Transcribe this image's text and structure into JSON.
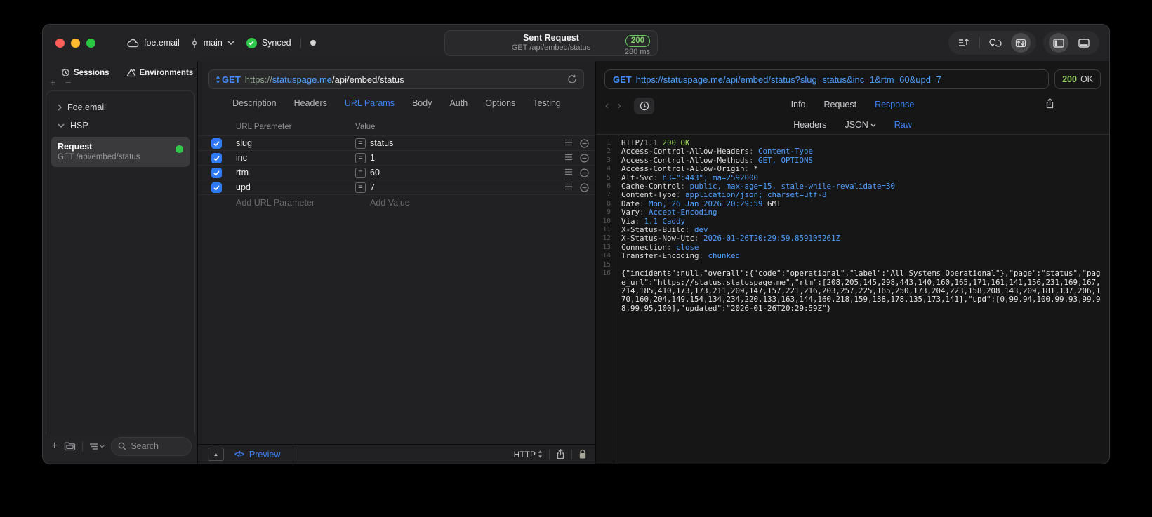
{
  "colors": {
    "accent_blue": "#3b82f7",
    "link_blue": "#4d9fff",
    "method_blue": "#3f8cff",
    "green": "#32c74b",
    "code_green": "#9fd45f",
    "badge_green": "#7ccf63"
  },
  "titlebar": {
    "project": "foe.email",
    "branch": "main",
    "sync_status": "Synced",
    "sent_request": {
      "title": "Sent Request",
      "subtitle": "GET /api/embed/status",
      "status_code": "200",
      "duration": "280 ms"
    }
  },
  "sidebar": {
    "tab_sessions": "Sessions",
    "tab_environments": "Environments",
    "tree": {
      "group1": "Foe.email",
      "group2": "HSP"
    },
    "request": {
      "title": "Request",
      "subtitle": "GET /api/embed/status"
    },
    "search_placeholder": "Search"
  },
  "request_editor": {
    "method": "GET",
    "url": {
      "scheme": "https://",
      "host": "statuspage.me",
      "path": "/api/embed/status"
    },
    "tabs": [
      "Description",
      "Headers",
      "URL Params",
      "Body",
      "Auth",
      "Options",
      "Testing"
    ],
    "active_tab": "URL Params",
    "params": {
      "col_name": "URL Parameter",
      "col_value": "Value",
      "rows": [
        {
          "name": "slug",
          "value": "status"
        },
        {
          "name": "inc",
          "value": "1"
        },
        {
          "name": "rtm",
          "value": "60"
        },
        {
          "name": "upd",
          "value": "7"
        }
      ],
      "add_name": "Add URL Parameter",
      "add_value": "Add Value"
    },
    "footer": {
      "preview": "Preview",
      "protocol": "HTTP"
    }
  },
  "response_viewer": {
    "method": "GET",
    "url": "https://statuspage.me/api/embed/status?slug=status&inc=1&rtm=60&upd=7",
    "status_code": "200",
    "status_text": "OK",
    "tabs": [
      "Info",
      "Request",
      "Response"
    ],
    "active_tab": "Response",
    "subtabs": [
      "Headers",
      "JSON",
      "Raw"
    ],
    "active_subtab": "Raw",
    "lines": [
      {
        "n": "1",
        "segs": [
          {
            "t": "HTTP/1.1 ",
            "c": "k"
          },
          {
            "t": "200 OK",
            "c": "g"
          }
        ]
      },
      {
        "n": "2",
        "segs": [
          {
            "t": "Access-Control-Allow-Headers",
            "c": "k"
          },
          {
            "t": ": ",
            "c": "p"
          },
          {
            "t": "Content-Type",
            "c": "v"
          }
        ]
      },
      {
        "n": "3",
        "segs": [
          {
            "t": "Access-Control-Allow-Methods",
            "c": "k"
          },
          {
            "t": ": ",
            "c": "p"
          },
          {
            "t": "GET, OPTIONS",
            "c": "v"
          }
        ]
      },
      {
        "n": "4",
        "segs": [
          {
            "t": "Access-Control-Allow-Origin",
            "c": "k"
          },
          {
            "t": ": ",
            "c": "p"
          },
          {
            "t": "*",
            "c": "k"
          }
        ]
      },
      {
        "n": "5",
        "segs": [
          {
            "t": "Alt-Svc",
            "c": "k"
          },
          {
            "t": ": ",
            "c": "p"
          },
          {
            "t": "h3=\":443\"; ma=2592000",
            "c": "v"
          }
        ]
      },
      {
        "n": "6",
        "segs": [
          {
            "t": "Cache-Control",
            "c": "k"
          },
          {
            "t": ": ",
            "c": "p"
          },
          {
            "t": "public, max-age=15, stale-while-revalidate=30",
            "c": "v"
          }
        ]
      },
      {
        "n": "7",
        "segs": [
          {
            "t": "Content-Type",
            "c": "k"
          },
          {
            "t": ": ",
            "c": "p"
          },
          {
            "t": "application/json; charset=utf-8",
            "c": "v"
          }
        ]
      },
      {
        "n": "8",
        "segs": [
          {
            "t": "Date",
            "c": "k"
          },
          {
            "t": ": ",
            "c": "p"
          },
          {
            "t": "Mon, 26 Jan 2026 20:29:59",
            "c": "v"
          },
          {
            "t": " GMT",
            "c": "k"
          }
        ]
      },
      {
        "n": "9",
        "segs": [
          {
            "t": "Vary",
            "c": "k"
          },
          {
            "t": ": ",
            "c": "p"
          },
          {
            "t": "Accept-Encoding",
            "c": "v"
          }
        ]
      },
      {
        "n": "10",
        "segs": [
          {
            "t": "Via",
            "c": "k"
          },
          {
            "t": ": ",
            "c": "p"
          },
          {
            "t": "1.1 Caddy",
            "c": "v"
          }
        ]
      },
      {
        "n": "11",
        "segs": [
          {
            "t": "X-Status-Build",
            "c": "k"
          },
          {
            "t": ": ",
            "c": "p"
          },
          {
            "t": "dev",
            "c": "v"
          }
        ]
      },
      {
        "n": "12",
        "segs": [
          {
            "t": "X-Status-Now-Utc",
            "c": "k"
          },
          {
            "t": ": ",
            "c": "p"
          },
          {
            "t": "2026-01-26T20:29:59.859105261Z",
            "c": "v"
          }
        ]
      },
      {
        "n": "13",
        "segs": [
          {
            "t": "Connection",
            "c": "k"
          },
          {
            "t": ": ",
            "c": "p"
          },
          {
            "t": "close",
            "c": "v"
          }
        ]
      },
      {
        "n": "14",
        "segs": [
          {
            "t": "Transfer-Encoding",
            "c": "k"
          },
          {
            "t": ": ",
            "c": "p"
          },
          {
            "t": "chunked",
            "c": "v"
          }
        ]
      },
      {
        "n": "15",
        "segs": []
      },
      {
        "n": "16",
        "segs": [
          {
            "t": "{\"incidents\":null,\"overall\":{\"code\":\"operational\",\"label\":\"All Systems Operational\"},\"page\":\"status\",\"page_url\":\"https://status.statuspage.me\",\"rtm\":[208,205,145,298,443,140,160,165,171,161,141,156,231,169,167,214,185,410,173,173,211,209,147,157,221,216,203,257,225,165,250,173,204,223,158,208,143,209,181,137,206,170,160,204,149,154,134,234,220,133,163,144,160,218,159,138,178,135,173,141],\"upd\":[0,99.94,100,99.93,99.98,99.95,100],\"updated\":\"2026-01-26T20:29:59Z\"}",
            "c": "w"
          }
        ]
      }
    ]
  }
}
